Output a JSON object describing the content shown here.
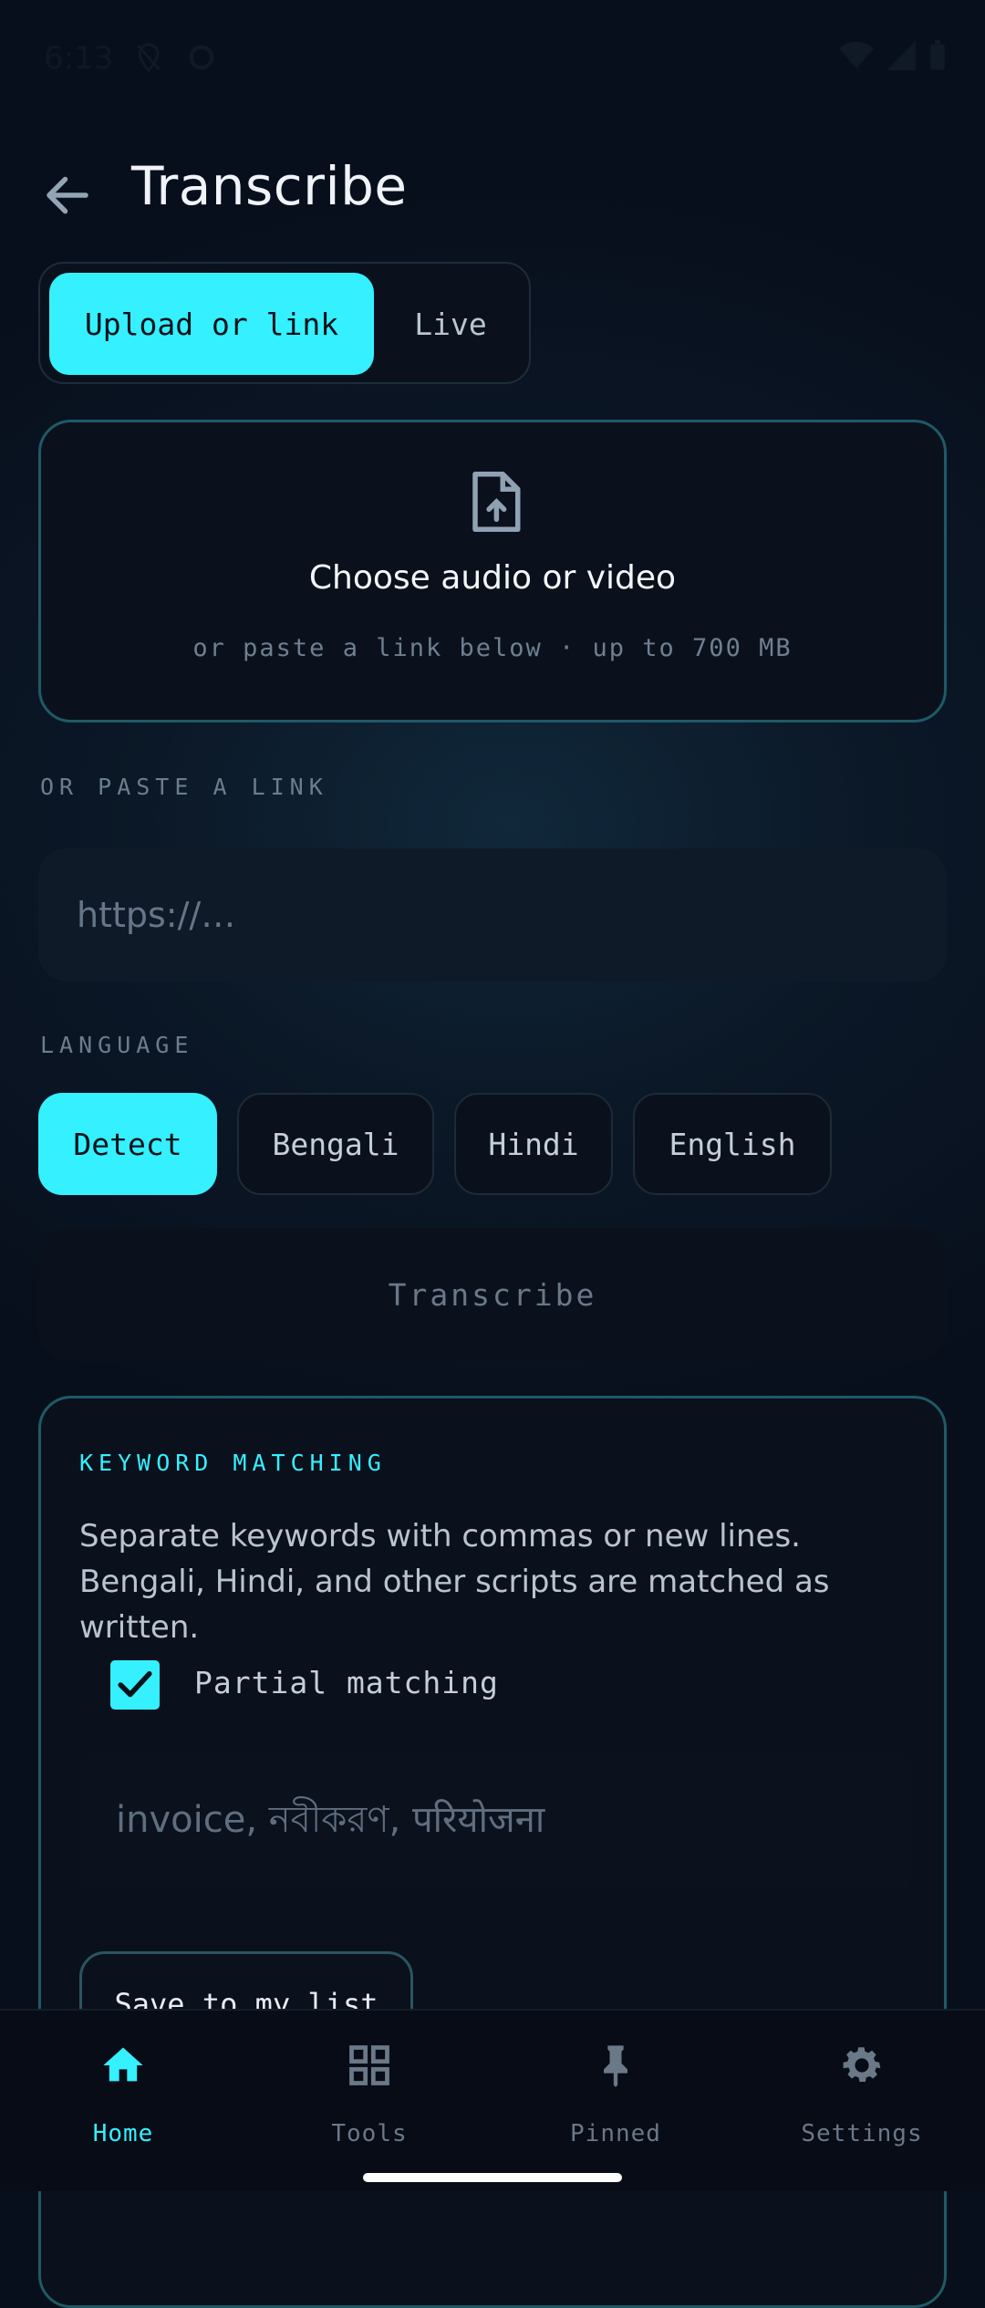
{
  "status": {
    "time": "6:13"
  },
  "appbar": {
    "title": "Transcribe"
  },
  "mode": {
    "options": [
      "Upload or link",
      "Live"
    ],
    "selected": "Upload or link"
  },
  "upload": {
    "heading": "Choose audio or video",
    "subtext": "or paste a link below · up to 700 MB"
  },
  "link": {
    "label": "OR PASTE A LINK",
    "placeholder": "https://…"
  },
  "language": {
    "label": "LANGUAGE",
    "options": [
      "Detect",
      "Bengali",
      "Hindi",
      "English"
    ],
    "selected": "Detect"
  },
  "transcribe_button": "Transcribe",
  "keywords": {
    "title": "KEYWORD MATCHING",
    "description": "Separate keywords with commas or new lines. Bengali, Hindi, and other scripts are matched as written.",
    "partial_label": "Partial matching",
    "partial_checked": true,
    "placeholder": "invoice, নবীকরণ, परियोजना",
    "save_label": "Save to my list"
  },
  "nav": {
    "items": [
      {
        "label": "Home",
        "icon": "home-icon",
        "active": true
      },
      {
        "label": "Tools",
        "icon": "grid-icon",
        "active": false
      },
      {
        "label": "Pinned",
        "icon": "pin-icon",
        "active": false
      },
      {
        "label": "Settings",
        "icon": "gear-icon",
        "active": false
      }
    ]
  },
  "colors": {
    "accent": "#35f0ff",
    "background": "#0b1827",
    "card_border": "#1e5a66"
  }
}
